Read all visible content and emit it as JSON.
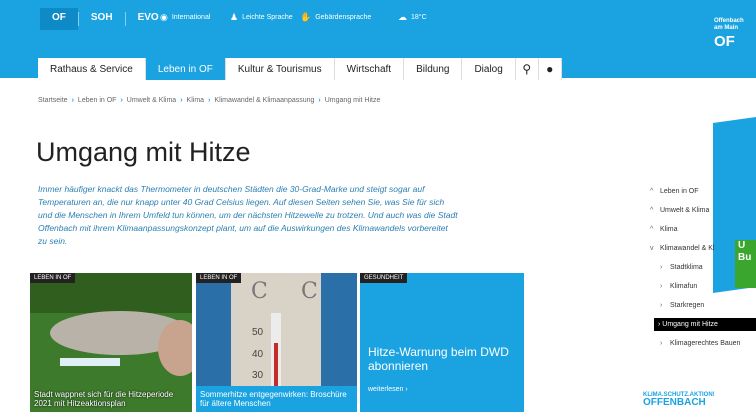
{
  "header": {
    "site_tabs": [
      "OF",
      "SOH",
      "EVO"
    ],
    "utilities": [
      {
        "icon": "globe-icon",
        "label": "International"
      },
      {
        "icon": "person-icon",
        "label": "Leichte Sprache"
      },
      {
        "icon": "hands-icon",
        "label": "Gebärdensprache"
      },
      {
        "icon": "weather-icon",
        "label": "18°C"
      }
    ],
    "logo": {
      "line1": "Offenbach",
      "line2": "am Main",
      "line3": "OF"
    }
  },
  "nav": {
    "items": [
      "Rathaus & Service",
      "Leben in OF",
      "Kultur & Tourismus",
      "Wirtschaft",
      "Bildung",
      "Dialog"
    ],
    "active_index": 1
  },
  "breadcrumb": [
    "Startseite",
    "Leben in OF",
    "Umwelt & Klima",
    "Klima",
    "Klimawandel & Klimaanpassung",
    "Umgang mit Hitze"
  ],
  "page": {
    "title": "Umgang mit Hitze",
    "intro": "Immer häufiger knackt das Thermometer in deutschen Städten die 30-Grad-Marke und steigt sogar auf Temperaturen an, die nur knapp unter 40 Grad Celsius liegen. Auf diesen Seiten sehen Sie, was Sie für sich und die Menschen in Ihrem Umfeld tun können, um der nächsten Hitzewelle zu trotzen. Und auch was die Stadt Offenbach mit ihrem Klimaanpassungskonzept plant, um auf die Auswirkungen des Klimawandels vorbereitet zu sein."
  },
  "cards": [
    {
      "tag": "LEBEN IN OF",
      "caption": "Stadt wappnet sich für die Hitzeperiode 2021 mit Hitzeaktionsplan"
    },
    {
      "tag": "LEBEN IN OF",
      "caption": "Sommerhitze entgegenwirken: Broschüre für ältere Menschen"
    },
    {
      "tag": "GESUNDHEIT",
      "caption": "Hitze-Warnung beim DWD abonnieren",
      "link": "weiterlesen"
    }
  ],
  "sidebar": {
    "items": [
      "Leben in OF",
      "Umwelt & Klima",
      "Klima",
      "Klimawandel & Kl"
    ],
    "subitems": [
      "Stadtklima",
      "Klimafun",
      "Starkregen",
      "Umgang mit Hitze",
      "Klimagerechtes Bauen"
    ],
    "current_sub": 3,
    "banner_text": "U Bu",
    "klima_label": "KLIMA.SCHUTZ.AKTION!",
    "klima_city": "OFFENBACH"
  },
  "colors": {
    "brand": "#1aa3e0",
    "accent_green": "#3aa62e"
  }
}
